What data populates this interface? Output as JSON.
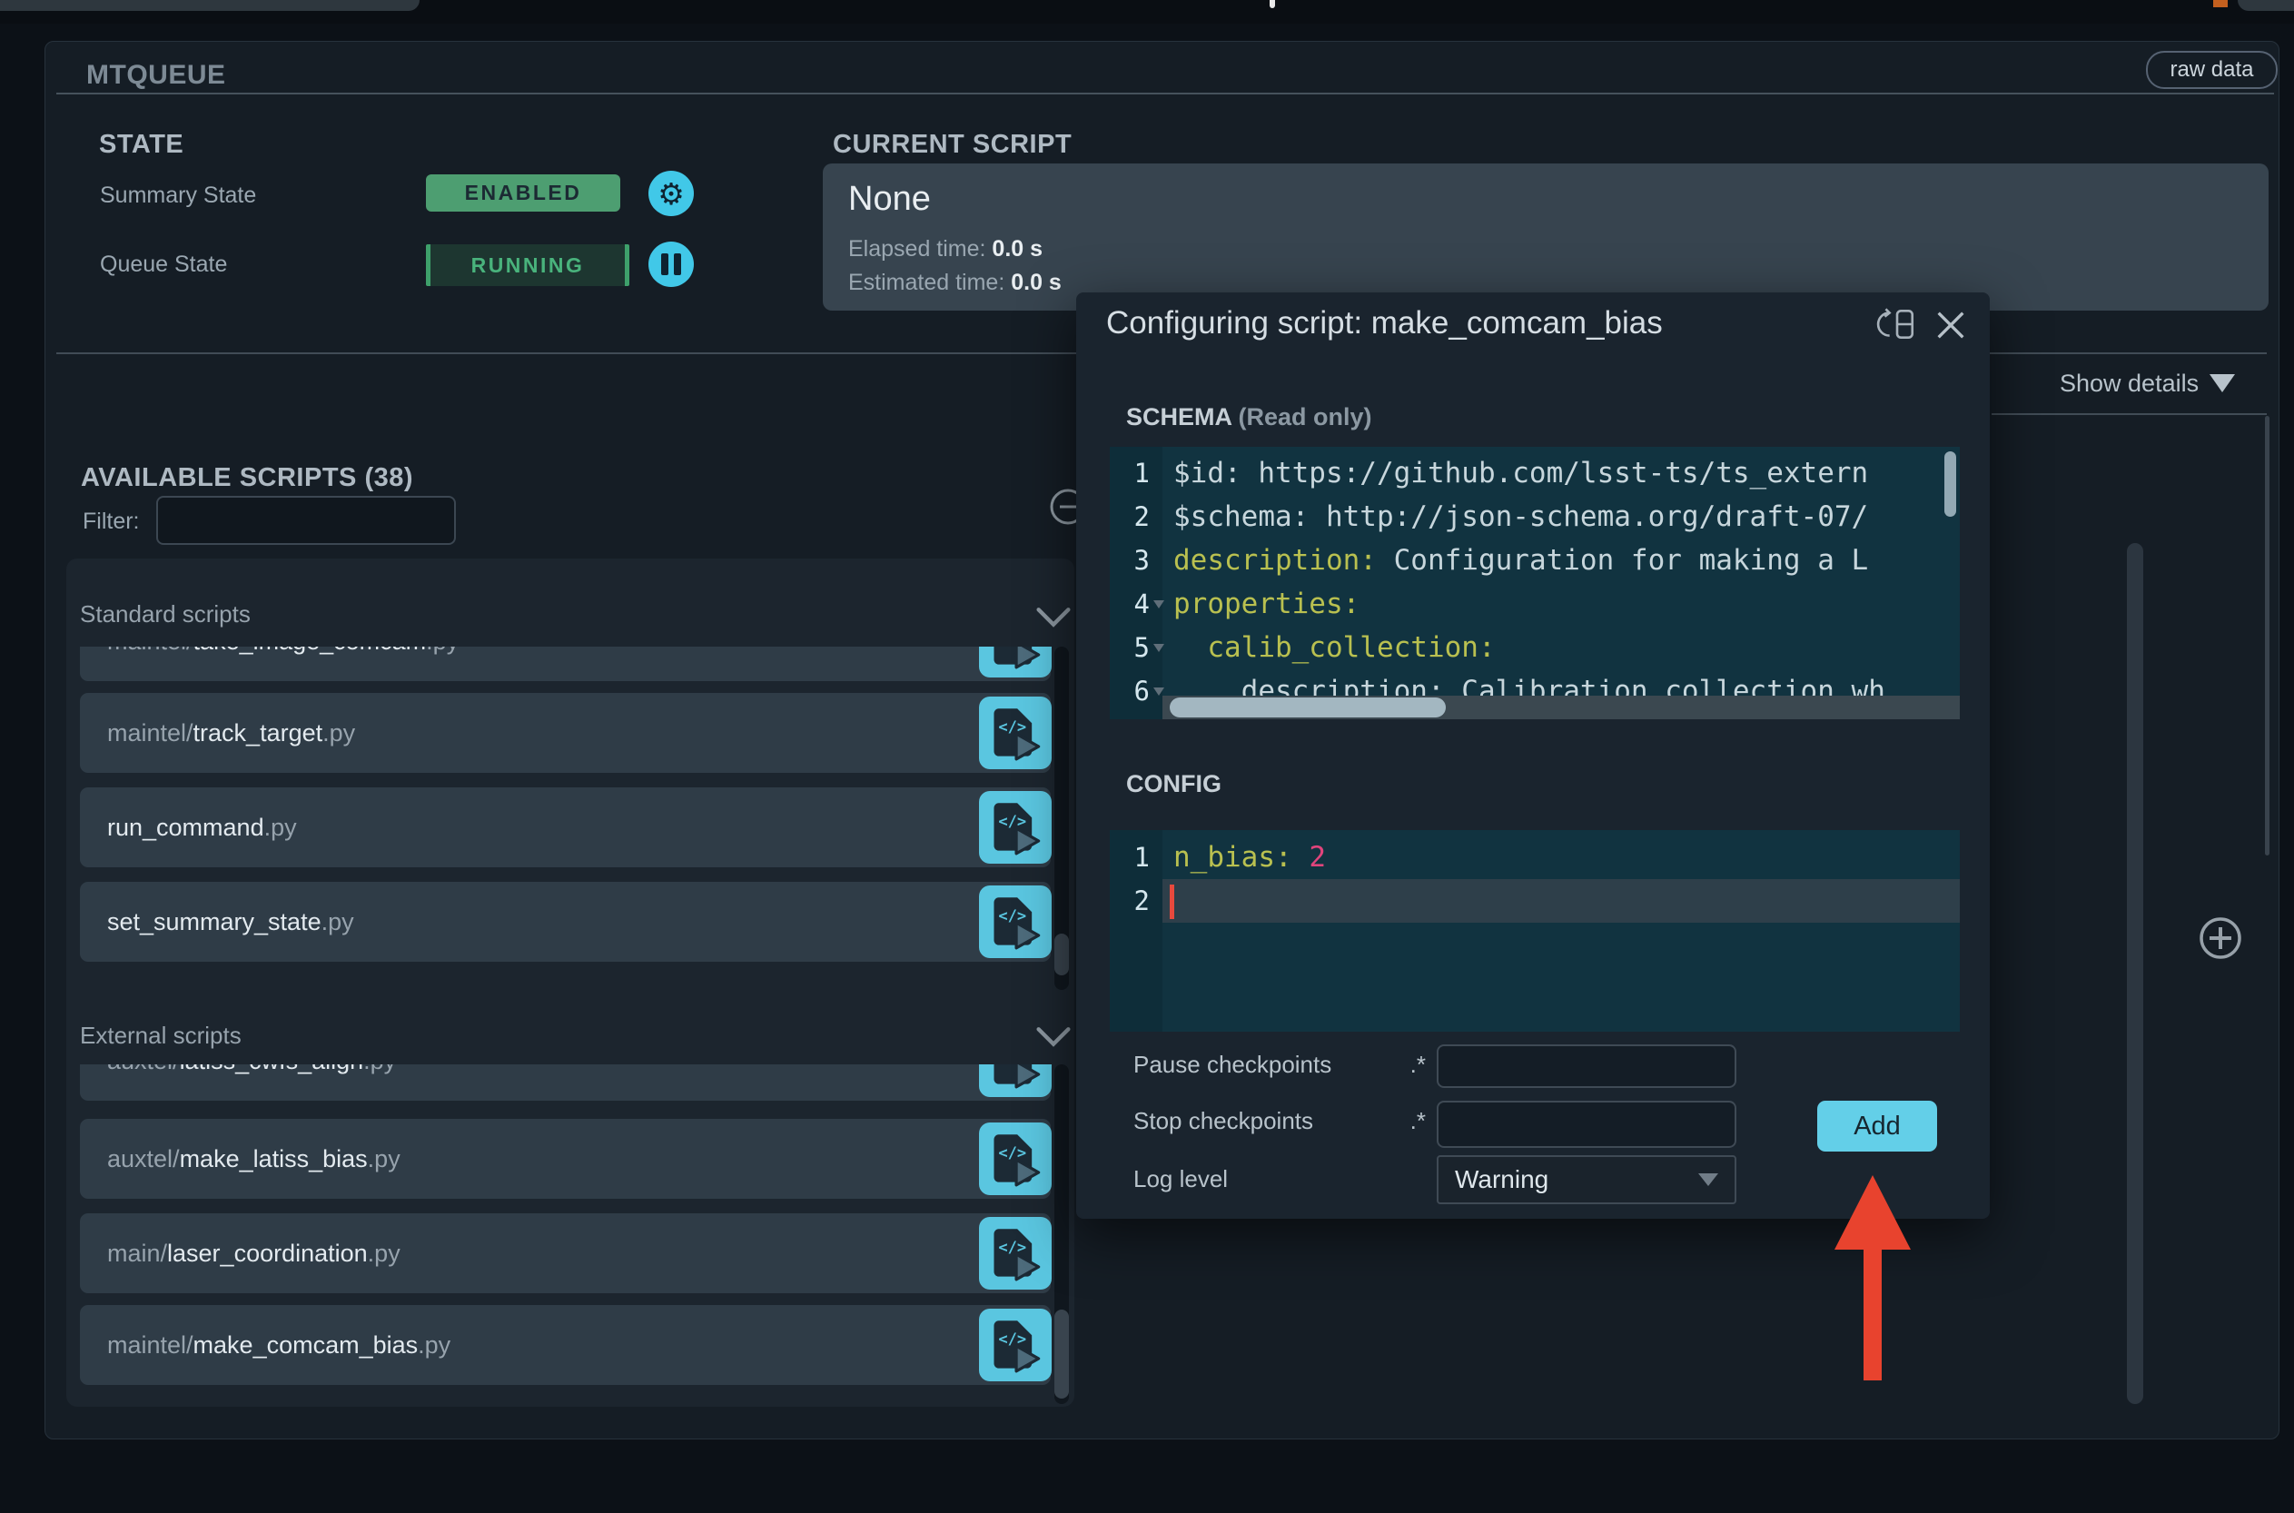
{
  "panel": {
    "title": "MTQUEUE",
    "raw_data_label": "raw data"
  },
  "state": {
    "heading": "STATE",
    "summary_label": "Summary State",
    "summary_value": "ENABLED",
    "queue_label": "Queue State",
    "queue_value": "RUNNING"
  },
  "current": {
    "heading": "CURRENT SCRIPT",
    "name": "None",
    "elapsed_label": "Elapsed time:",
    "elapsed_value": "0.0 s",
    "estimated_label": "Estimated time:",
    "estimated_value": "0.0 s"
  },
  "details": {
    "show_label": "Show details"
  },
  "available": {
    "heading": "AVAILABLE SCRIPTS (38)",
    "filter_label": "Filter:",
    "filter_value": "",
    "sections": [
      {
        "label": "Standard scripts",
        "items": [
          {
            "prefix": "maintel/",
            "stem": "take_image_comcam",
            "ext": ".py"
          },
          {
            "prefix": "maintel/",
            "stem": "track_target",
            "ext": ".py"
          },
          {
            "prefix": "",
            "stem": "run_command",
            "ext": ".py"
          },
          {
            "prefix": "",
            "stem": "set_summary_state",
            "ext": ".py"
          }
        ]
      },
      {
        "label": "External scripts",
        "items": [
          {
            "prefix": "auxtel/",
            "stem": "latiss_cwfs_align",
            "ext": ".py"
          },
          {
            "prefix": "auxtel/",
            "stem": "make_latiss_bias",
            "ext": ".py"
          },
          {
            "prefix": "main/",
            "stem": "laser_coordination",
            "ext": ".py"
          },
          {
            "prefix": "maintel/",
            "stem": "make_comcam_bias",
            "ext": ".py"
          }
        ]
      }
    ]
  },
  "modal": {
    "title": "Configuring script: make_comcam_bias",
    "schema_label": "SCHEMA",
    "schema_note": "(Read only)",
    "schema_lines": [
      {
        "num": "1",
        "key": "",
        "text": "$id: https://github.com/lsst-ts/ts_extern"
      },
      {
        "num": "2",
        "key": "",
        "text": "$schema: http://json-schema.org/draft-07/"
      },
      {
        "num": "3",
        "key": "description:",
        "text": " Configuration for making a L"
      },
      {
        "num": "4",
        "key": "properties:",
        "text": ""
      },
      {
        "num": "5",
        "key": "  calib_collection:",
        "text": ""
      },
      {
        "num": "6",
        "key": "",
        "text": "    description: Calibration collection wh"
      }
    ],
    "config_label": "CONFIG",
    "config_lines": [
      {
        "num": "1",
        "key": "n_bias:",
        "value": " 2"
      },
      {
        "num": "2",
        "key": "",
        "value": ""
      }
    ],
    "pause_label": "Pause checkpoints",
    "pause_suffix": ".*",
    "pause_value": "",
    "stop_label": "Stop checkpoints",
    "stop_suffix": ".*",
    "stop_value": "",
    "log_label": "Log level",
    "log_value": "Warning",
    "add_label": "Add"
  },
  "colors": {
    "accent_cyan": "#41c8e8",
    "enabled_green": "#4d9e71",
    "running_green": "#49b37c",
    "arrow_red": "#e8432e",
    "code_yellow": "#b9c050",
    "code_pink": "#e0447c"
  }
}
